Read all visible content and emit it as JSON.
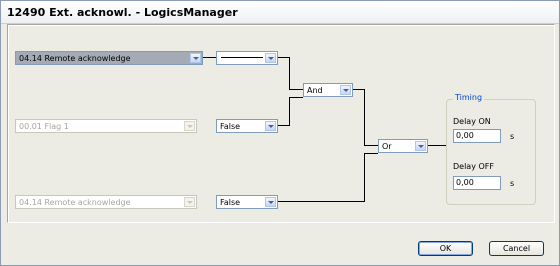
{
  "window": {
    "title": "12490 Ext. acknowl. - LogicsManager"
  },
  "inputs": [
    {
      "value": "04.14 Remote acknowledge",
      "state": "selected"
    },
    {
      "value": "00.01 Flag 1",
      "state": "disabled"
    },
    {
      "value": "04.14 Remote acknowledge",
      "state": "disabled"
    }
  ],
  "signs": [
    {
      "value": "",
      "symbol": "line"
    },
    {
      "value": "False"
    },
    {
      "value": "False"
    }
  ],
  "operators": [
    {
      "value": "And"
    },
    {
      "value": "Or"
    }
  ],
  "timing": {
    "legend": "Timing",
    "delay_on_label": "Delay ON",
    "delay_on_value": "0,00",
    "delay_on_unit": "s",
    "delay_off_label": "Delay OFF",
    "delay_off_value": "0,00",
    "delay_off_unit": "s"
  },
  "buttons": {
    "ok": "OK",
    "cancel": "Cancel"
  }
}
